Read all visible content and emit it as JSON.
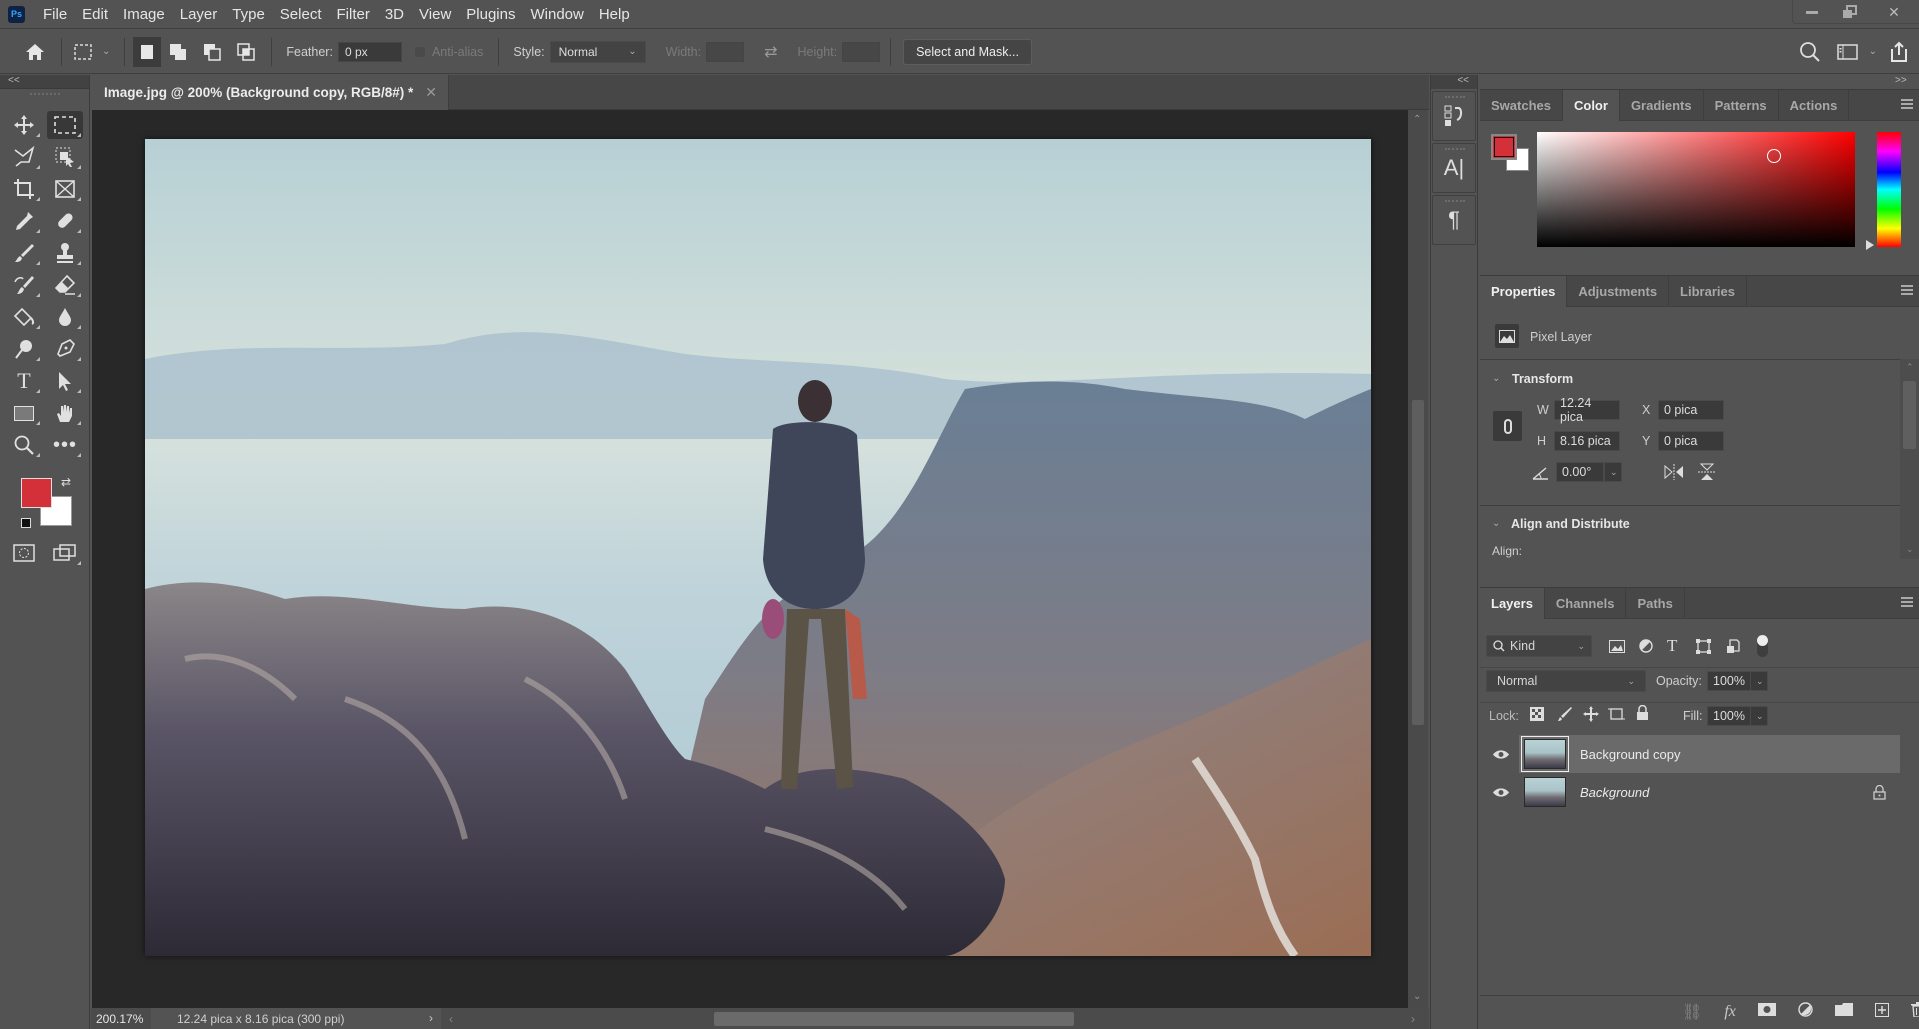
{
  "app": {
    "logo": "Ps",
    "accent": "#31a8ff"
  },
  "menu": [
    "File",
    "Edit",
    "Image",
    "Layer",
    "Type",
    "Select",
    "Filter",
    "3D",
    "View",
    "Plugins",
    "Window",
    "Help"
  ],
  "window_controls": {
    "minimize": "minimize-icon",
    "restore": "restore-icon",
    "close": "close-icon"
  },
  "options_bar": {
    "feather_label": "Feather:",
    "feather_value": "0 px",
    "antialias_label": "Anti-alias",
    "style_label": "Style:",
    "style_value": "Normal",
    "width_label": "Width:",
    "width_value": "",
    "height_label": "Height:",
    "height_value": "",
    "select_mask_label": "Select and Mask..."
  },
  "document": {
    "tab_title": "Image.jpg @ 200% (Background copy, RGB/8#) *",
    "zoom": "200.17%",
    "doc_info": "12.24 pica x 8.16 pica (300 ppi)"
  },
  "toolbar": {
    "collapse": "<<",
    "foreground_color": "#d4303a",
    "background_color": "#ffffff"
  },
  "dock": {
    "collapse": "<<",
    "expand": ">>"
  },
  "color_panel": {
    "tabs": [
      "Swatches",
      "Color",
      "Gradients",
      "Patterns",
      "Actions"
    ],
    "active_tab": "Color",
    "foreground_color": "#d4303a",
    "background_color": "#ffffff",
    "hue": "#ff0000"
  },
  "properties_panel": {
    "tabs": [
      "Properties",
      "Adjustments",
      "Libraries"
    ],
    "active_tab": "Properties",
    "layer_type": "Pixel Layer",
    "transform_title": "Transform",
    "w_label": "W",
    "w_value": "12.24 pica",
    "h_label": "H",
    "h_value": "8.16 pica",
    "x_label": "X",
    "x_value": "0 pica",
    "y_label": "Y",
    "y_value": "0 pica",
    "angle_value": "0.00°",
    "align_title": "Align and Distribute",
    "align_label": "Align:"
  },
  "layers_panel": {
    "tabs": [
      "Layers",
      "Channels",
      "Paths"
    ],
    "active_tab": "Layers",
    "filter_kind": "Kind",
    "blend_mode": "Normal",
    "opacity_label": "Opacity:",
    "opacity_value": "100%",
    "lock_label": "Lock:",
    "fill_label": "Fill:",
    "fill_value": "100%",
    "layers": [
      {
        "name": "Background copy",
        "visible": true,
        "selected": true,
        "locked": false
      },
      {
        "name": "Background",
        "visible": true,
        "selected": false,
        "locked": true
      }
    ]
  }
}
